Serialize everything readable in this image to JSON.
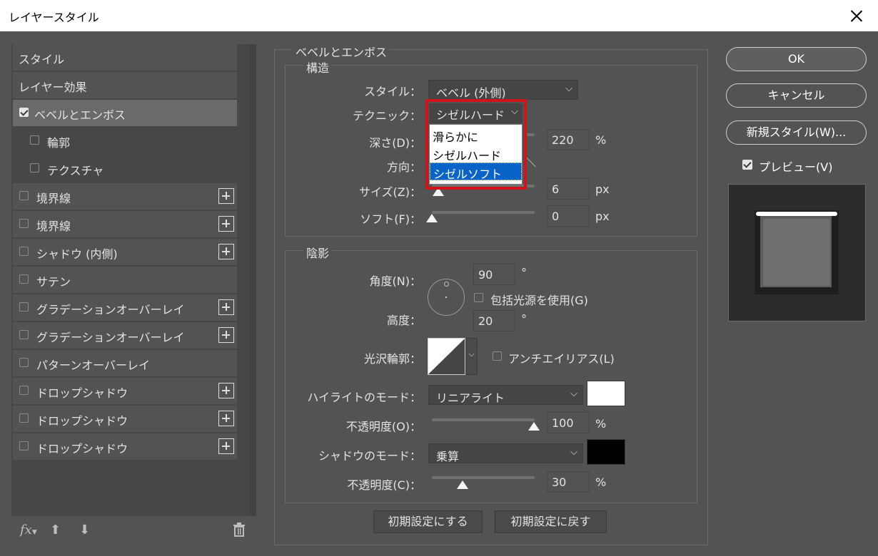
{
  "window": {
    "title": "レイヤースタイル"
  },
  "left": {
    "items": [
      {
        "label": "スタイル"
      },
      {
        "label": "レイヤー効果"
      },
      {
        "label": "ベベルとエンボス",
        "checked": true,
        "selected": true
      },
      {
        "label": "輪郭"
      },
      {
        "label": "テクスチャ"
      },
      {
        "label": "境界線"
      },
      {
        "label": "境界線"
      },
      {
        "label": "シャドウ (内側)"
      },
      {
        "label": "サテン"
      },
      {
        "label": "グラデーションオーバーレイ"
      },
      {
        "label": "グラデーションオーバーレイ"
      },
      {
        "label": "パターンオーバーレイ"
      },
      {
        "label": "ドロップシャドウ"
      },
      {
        "label": "ドロップシャドウ"
      },
      {
        "label": "ドロップシャドウ"
      }
    ],
    "fx_label": "fx"
  },
  "bevel": {
    "legend": "ベベルとエンボス",
    "structure_legend": "構造",
    "style_label": "スタイル：",
    "style_value": "ベベル (外側)",
    "technique_label": "テクニック：",
    "technique_value": "シゼルハード",
    "technique_options": [
      "滑らかに",
      "シゼルハード",
      "シゼルソフト"
    ],
    "depth_label": "深さ(D)：",
    "depth_value": "220",
    "depth_unit": "%",
    "direction_label": "方向：",
    "size_label": "サイズ(Z)：",
    "size_value": "6",
    "size_unit": "px",
    "soften_label": "ソフト(F)：",
    "soften_value": "0",
    "soften_unit": "px"
  },
  "shading": {
    "legend": "陰影",
    "angle_label": "角度(N)：",
    "angle_value": "90",
    "angle_unit": "°",
    "global_light_label": "包括光源を使用(G)",
    "altitude_label": "高度：",
    "altitude_value": "20",
    "altitude_unit": "°",
    "gloss_label": "光沢輪郭：",
    "antialias_label": "アンチエイリアス(L)",
    "highlight_mode_label": "ハイライトのモード：",
    "highlight_mode_value": "リニアライト",
    "highlight_color": "#ffffff",
    "highlight_opacity_label": "不透明度(O)：",
    "highlight_opacity_value": "100",
    "highlight_opacity_unit": "%",
    "shadow_mode_label": "シャドウのモード：",
    "shadow_mode_value": "乗算",
    "shadow_color": "#000000",
    "shadow_opacity_label": "不透明度(C)：",
    "shadow_opacity_value": "30",
    "shadow_opacity_unit": "%"
  },
  "buttons": {
    "make_default": "初期設定にする",
    "reset_default": "初期設定に戻す",
    "ok": "OK",
    "cancel": "キャンセル",
    "new_style": "新規スタイル(W)...",
    "preview": "プレビュー(V)"
  },
  "icons": [
    "close-icon",
    "plus-icon",
    "fx-icon",
    "arrow-up-icon",
    "arrow-down-icon",
    "trash-icon",
    "chevron-down-icon",
    "checkbox-icon"
  ]
}
